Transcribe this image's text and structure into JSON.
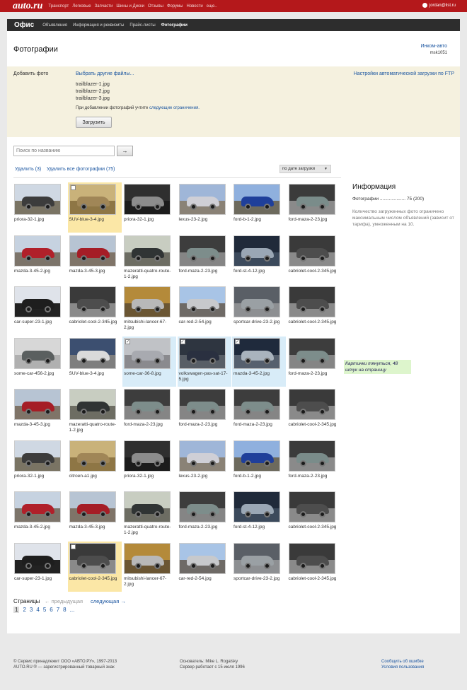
{
  "topbar": {
    "logo": "auto.ru",
    "nav": [
      "Транспорт",
      "Легковые",
      "Запчасти",
      "Шины и Диски",
      "Отзывы",
      "Форумы",
      "Новости",
      "еще.."
    ],
    "user": "jordan@list.ru"
  },
  "sitenav": {
    "title": "Офис",
    "items": [
      "Объявления",
      "Информация и реквизиты",
      "Прайс-листы",
      "Фотографии"
    ],
    "active_index": 3
  },
  "page": {
    "title": "Фотографии",
    "company": "Инком-авто",
    "company_id": "msk1051"
  },
  "upload": {
    "label": "Добавить фото",
    "choose_link": "Выбрать другие файлы...",
    "ftp_link": "Настройки автоматической загрузки по FTP",
    "files": [
      "trailblazer-1.jpg",
      "trailblazer-2.jpg",
      "trailblazer-3.jpg"
    ],
    "limits_prefix": "При добавлении фотографий учтите",
    "limits_link": "следующие ограничения.",
    "button": "Загрузить"
  },
  "search": {
    "placeholder": "Поиск по названию",
    "button": "→"
  },
  "actions": {
    "delete_selected": "Удалить (3)",
    "delete_all": "Удалить все фотографии (75)",
    "sort": "по дате загрузки"
  },
  "photos": [
    {
      "name": "priora-32-1.jpg",
      "sky": "#cfd8e3",
      "ground": "#7a7464",
      "car": "#3c3c3c"
    },
    {
      "name": "SUV-blue-3-4.jpg",
      "sky": "#c9b27a",
      "ground": "#8e7645",
      "car": "#a08657",
      "state": "hover"
    },
    {
      "name": "priora-32-1.jpg",
      "sky": "#2f2f2f",
      "ground": "#1c1c1c",
      "car": "#8c8c8c"
    },
    {
      "name": "lexus-23-2.jpg",
      "sky": "#9fb6d8",
      "ground": "#8a8276",
      "car": "#cfcfd6"
    },
    {
      "name": "ford-b-1-2.jpg",
      "sky": "#8fb0de",
      "ground": "#6d6a5d",
      "car": "#1f3f9a"
    },
    {
      "name": "ford-maza-2-23.jpg",
      "sky": "#3b3b3b",
      "ground": "#8a8a8a",
      "car": "#7a8c8a"
    },
    {
      "name": "mazda-3-45-2.jpg",
      "sky": "#c6d2e0",
      "ground": "#7c746a",
      "car": "#b0202a"
    },
    {
      "name": "mazda-3-45-3.jpg",
      "sky": "#b7c4d3",
      "ground": "#7f7468",
      "car": "#a51d26"
    },
    {
      "name": "mazeratti-quatro-route-1-2.jpg",
      "sky": "#c8cdc1",
      "ground": "#6d6d63",
      "car": "#303434"
    },
    {
      "name": "ford-maza-2-23.jpg",
      "sky": "#3d3d3d",
      "ground": "#858585",
      "car": "#7d8d8b"
    },
    {
      "name": "ford-st-4-12.jpg",
      "sky": "#202a3a",
      "ground": "#3c4a5c",
      "car": "#9aa7b5"
    },
    {
      "name": "cabriolet-cool-2-345.jpg",
      "sky": "#3a3a3a",
      "ground": "#8a8a8a",
      "car": "#4d4d4d"
    },
    {
      "name": "car-super-23-1.jpg",
      "sky": "#dfe3ea",
      "ground": "#222222",
      "car": "#1e1e1e"
    },
    {
      "name": "cabriolet-cool-2-345.jpg",
      "sky": "#3a3a3a",
      "ground": "#8a8a8a",
      "car": "#4d4d4d"
    },
    {
      "name": "mitsubishi-lancer-67-2.jpg",
      "sky": "#b48a3a",
      "ground": "#6b5633",
      "car": "#b8b8b8"
    },
    {
      "name": "car-red-2-54.jpg",
      "sky": "#a8c4e6",
      "ground": "#6e6a66",
      "car": "#c7c9cc"
    },
    {
      "name": "sportcar-drive-23-2.jpg",
      "sky": "#5a5f66",
      "ground": "#8d8f92",
      "car": "#9aa0a4"
    },
    {
      "name": "cabriolet-cool-2-345.jpg",
      "sky": "#3a3a3a",
      "ground": "#8a8a8a",
      "car": "#4d4d4d"
    },
    {
      "name": "some-car-456-2.jpg",
      "sky": "#d7d7d7",
      "ground": "#b0b0b0",
      "car": "#5a5f5f"
    },
    {
      "name": "SUV-blue-3-4.jpg",
      "sky": "#3c4f70",
      "ground": "#7e7e7e",
      "car": "#dadada"
    },
    {
      "name": "some-car-36-8.jpg",
      "sky": "#c0c2c6",
      "ground": "#8a8a8e",
      "car": "#a8aab0",
      "state": "selected"
    },
    {
      "name": "volkswagen-pas-sat-17-5.jpg",
      "sky": "#2e3540",
      "ground": "#585e66",
      "car": "#2a3040",
      "state": "selected"
    },
    {
      "name": "mazda-3-45-2.jpg",
      "sky": "#1f2a3c",
      "ground": "#56606e",
      "car": "#a9b3bd",
      "state": "selected"
    },
    {
      "name": "ford-maza-2-23.jpg",
      "sky": "#3d3d3d",
      "ground": "#858585",
      "car": "#7d8d8b"
    },
    {
      "name": "mazda-3-45-3.jpg",
      "sky": "#b7c4d3",
      "ground": "#7f7468",
      "car": "#a51d26"
    },
    {
      "name": "mazeratti-quatro-route-1-2.jpg",
      "sky": "#c8cdc1",
      "ground": "#6d6d63",
      "car": "#303434"
    },
    {
      "name": "ford-maza-2-23.jpg",
      "sky": "#3d3d3d",
      "ground": "#858585",
      "car": "#7d8d8b"
    },
    {
      "name": "ford-maza-2-23.jpg",
      "sky": "#3d3d3d",
      "ground": "#858585",
      "car": "#7d8d8b"
    },
    {
      "name": "ford-maza-2-23.jpg",
      "sky": "#3d3d3d",
      "ground": "#858585",
      "car": "#7d8d8b"
    },
    {
      "name": "cabriolet-cool-2-345.jpg",
      "sky": "#3a3a3a",
      "ground": "#8a8a8a",
      "car": "#4d4d4d"
    },
    {
      "name": "priora-32-1.jpg",
      "sky": "#cfd8e3",
      "ground": "#7a7464",
      "car": "#3c3c3c"
    },
    {
      "name": "citroen-a1.jpg",
      "sky": "#c9b27a",
      "ground": "#8e7645",
      "car": "#a08657"
    },
    {
      "name": "priora-32-1.jpg",
      "sky": "#2f2f2f",
      "ground": "#1c1c1c",
      "car": "#8c8c8c"
    },
    {
      "name": "lexus-23-2.jpg",
      "sky": "#9fb6d8",
      "ground": "#8a8276",
      "car": "#cfcfd6"
    },
    {
      "name": "ford-b-1-2.jpg",
      "sky": "#8fb0de",
      "ground": "#6d6a5d",
      "car": "#1f3f9a"
    },
    {
      "name": "ford-maza-2-23.jpg",
      "sky": "#3b3b3b",
      "ground": "#8a8a8a",
      "car": "#7a8c8a"
    },
    {
      "name": "mazda-3-45-2.jpg",
      "sky": "#c6d2e0",
      "ground": "#7c746a",
      "car": "#b0202a"
    },
    {
      "name": "mazda-3-45-3.jpg",
      "sky": "#b7c4d3",
      "ground": "#7f7468",
      "car": "#a51d26"
    },
    {
      "name": "mazeratti-quatro-route-1-2.jpg",
      "sky": "#c8cdc1",
      "ground": "#6d6d63",
      "car": "#303434"
    },
    {
      "name": "ford-maza-2-23.jpg",
      "sky": "#3d3d3d",
      "ground": "#858585",
      "car": "#7d8d8b"
    },
    {
      "name": "ford-st-4-12.jpg",
      "sky": "#202a3a",
      "ground": "#3c4a5c",
      "car": "#9aa7b5"
    },
    {
      "name": "cabriolet-cool-2-345.jpg",
      "sky": "#3a3a3a",
      "ground": "#8a8a8a",
      "car": "#4d4d4d"
    },
    {
      "name": "car-super-23-1.jpg",
      "sky": "#dfe3ea",
      "ground": "#222222",
      "car": "#1e1e1e"
    },
    {
      "name": "cabriolet-cool-2-345.jpg",
      "sky": "#3a3a3a",
      "ground": "#8a8a8a",
      "car": "#4d4d4d",
      "state": "hover"
    },
    {
      "name": "mitsubishi-lancer-67-2.jpg",
      "sky": "#b48a3a",
      "ground": "#6b5633",
      "car": "#b8b8b8"
    },
    {
      "name": "car-red-2-54.jpg",
      "sky": "#a8c4e6",
      "ground": "#6e6a66",
      "car": "#c7c9cc"
    },
    {
      "name": "sportcar-drive-23-2.jpg",
      "sky": "#5a5f66",
      "ground": "#8d8f92",
      "car": "#9aa0a4"
    },
    {
      "name": "cabriolet-cool-2-345.jpg",
      "sky": "#3a3a3a",
      "ground": "#8a8a8a",
      "car": "#4d4d4d"
    }
  ],
  "info": {
    "title": "Информация",
    "photos_label": "Фотографии",
    "photos_value": "75 (200)",
    "text": "Количество загруженных фото ограничено максимальным числом объявлений (зависит от тарифа), умноженным на 10."
  },
  "note": "Картинки тянуться, 48 штук на страницу",
  "pagination": {
    "label": "Страницы",
    "prev": "← предыдущая",
    "next": "следующая →",
    "pages": [
      "1",
      "2",
      "3",
      "4",
      "5",
      "6",
      "7",
      "8",
      "..."
    ],
    "current": "1"
  },
  "footer": {
    "line1": "© Сервис принадлежит ООО «АВТО.РУ», 1997-2013",
    "line2": "AUTO.RU ® — зарегистрированный товарный знак",
    "founder": "Основатель: Mike L. Rogalsky",
    "since": "Сервер работает с 15 июля 1996",
    "report": "Сообщить об ошибке",
    "terms": "Условия пользования"
  }
}
